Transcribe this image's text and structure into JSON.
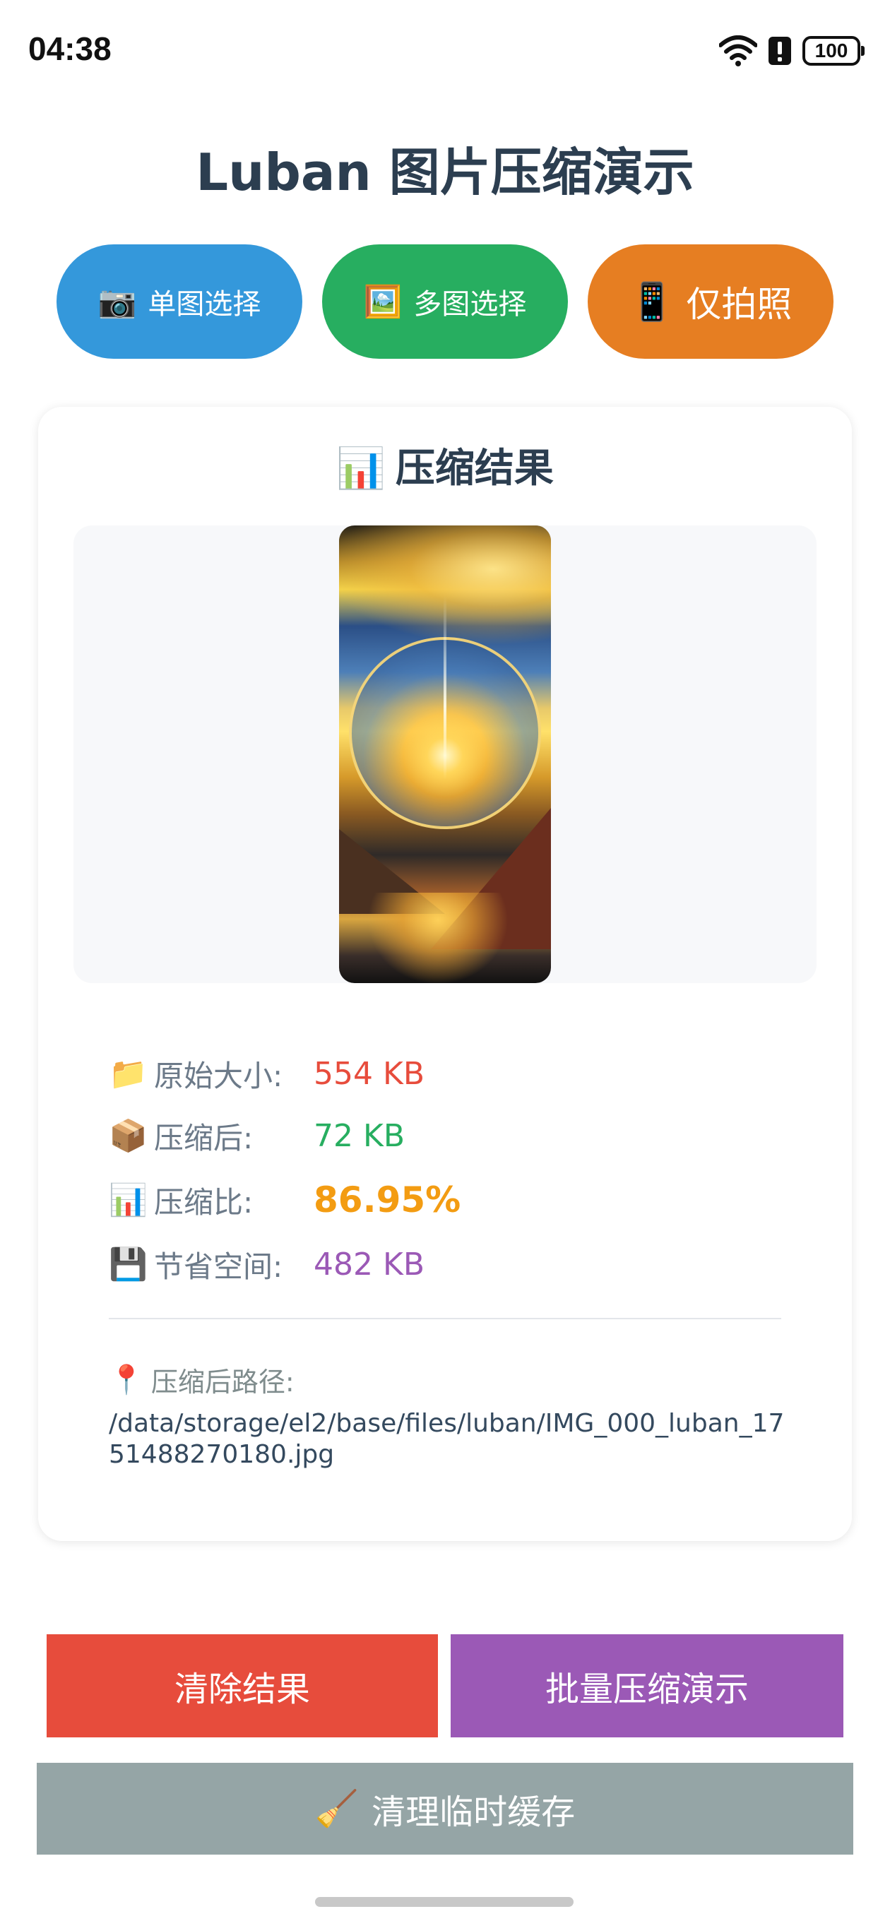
{
  "status_bar": {
    "time": "04:38",
    "wifi_icon": "wifi-icon",
    "alert_icon": "alert-icon",
    "battery": "100"
  },
  "title": "Luban 图片压缩演示",
  "top_buttons": {
    "single": {
      "emoji": "📷",
      "label": "单图选择",
      "color": "#3498db"
    },
    "multi": {
      "emoji": "🖼️",
      "label": "多图选择",
      "color": "#27ae60"
    },
    "camera": {
      "emoji": "📱",
      "label": "仅拍照",
      "color": "#e67e22"
    }
  },
  "result_card": {
    "emoji": "📊",
    "title": "压缩结果",
    "stats": [
      {
        "emoji": "📁",
        "label": "原始大小:",
        "value": "554 KB",
        "color": "#e74c3c"
      },
      {
        "emoji": "📦",
        "label": "压缩后:",
        "value": "72 KB",
        "color": "#27ae60"
      },
      {
        "emoji": "📊",
        "label": "压缩比:",
        "value": "86.95%",
        "color": "#f39c12"
      },
      {
        "emoji": "💾",
        "label": "节省空间:",
        "value": "482 KB",
        "color": "#9b59b6"
      }
    ],
    "path": {
      "emoji": "📍",
      "label": "压缩后路径:",
      "value": "/data/storage/el2/base/files/luban/IMG_000_luban_1751488270180.jpg"
    }
  },
  "bottom_buttons": {
    "clear": {
      "label": "清除结果",
      "color": "#e74c3c"
    },
    "batch": {
      "label": "批量压缩演示",
      "color": "#9b59b6"
    },
    "cache": {
      "emoji": "🧹",
      "label": "清理临时缓存",
      "color": "#95a5a6"
    }
  }
}
